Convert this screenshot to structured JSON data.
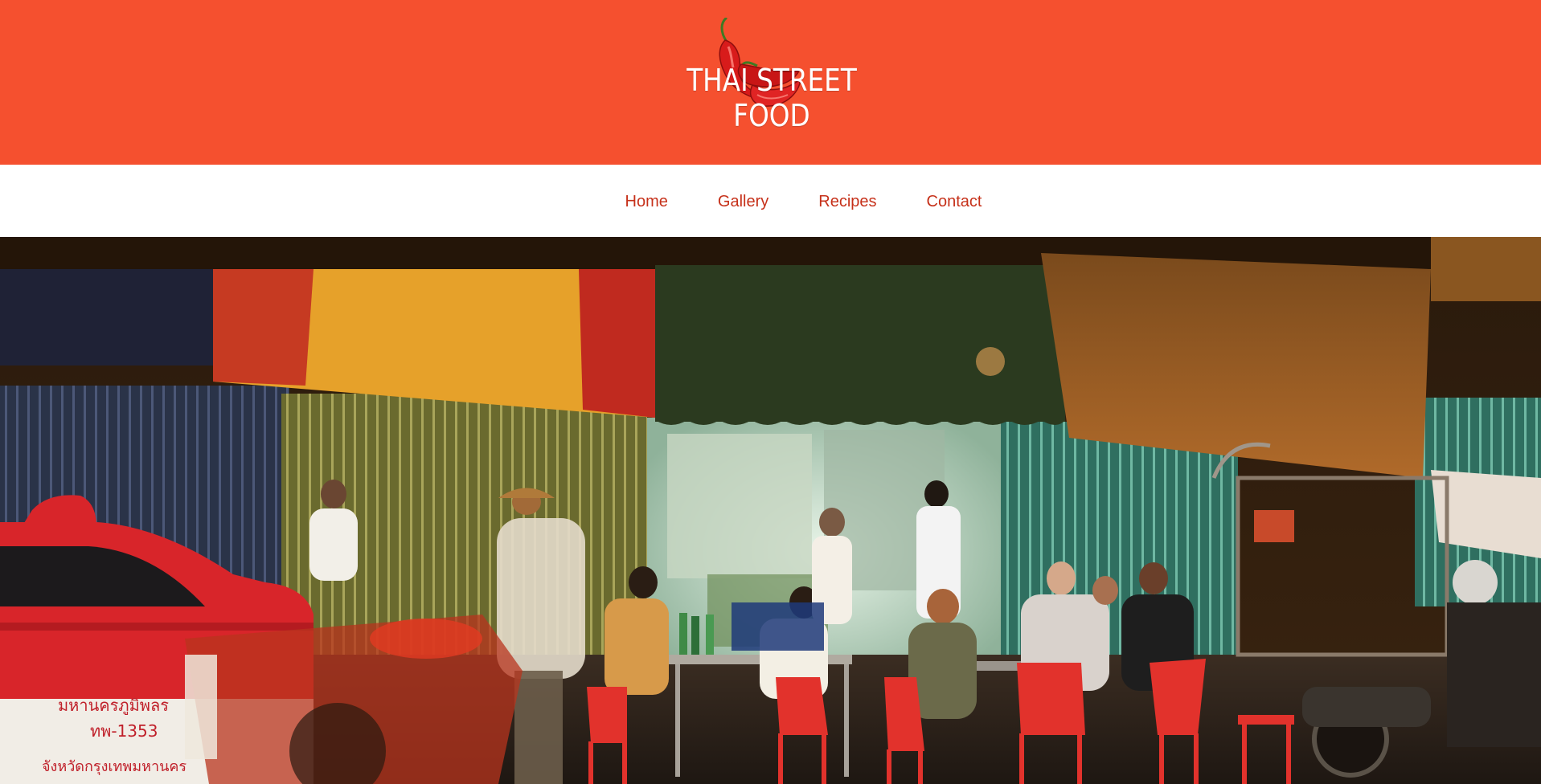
{
  "header": {
    "logo_text": "THAI STREET FOOD",
    "background_color": "#f5502f",
    "logo_icon": "chili-pepper-icon"
  },
  "nav": {
    "items": [
      {
        "label": "Home"
      },
      {
        "label": "Gallery"
      },
      {
        "label": "Recipes"
      },
      {
        "label": "Contact"
      }
    ],
    "link_color": "#c6311a"
  },
  "hero": {
    "image": "night-street-food-stall-photo",
    "taxi_signage": "มหานครภูมิพลร",
    "taxi_plate": "ทพ-1353",
    "taxi_small_text": "จังหวัดกรุงเทพมหานคร"
  }
}
